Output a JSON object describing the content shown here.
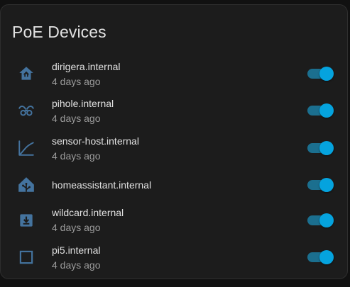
{
  "card": {
    "title": "PoE Devices"
  },
  "colors": {
    "icon": "#44739e",
    "toggle_on": "#05a3de",
    "toggle_track": "#1b6f8f"
  },
  "devices": [
    {
      "name": "dirigera.internal",
      "last_changed": "4 days ago",
      "icon": "home-hub-icon",
      "on": true
    },
    {
      "name": "pihole.internal",
      "last_changed": "4 days ago",
      "icon": "pi-hole-icon",
      "on": true
    },
    {
      "name": "sensor-host.internal",
      "last_changed": "4 days ago",
      "icon": "chart-line-icon",
      "on": true
    },
    {
      "name": "homeassistant.internal",
      "last_changed": "",
      "icon": "home-assistant-icon",
      "on": true
    },
    {
      "name": "wildcard.internal",
      "last_changed": "4 days ago",
      "icon": "tray-arrow-down-icon",
      "on": true
    },
    {
      "name": "pi5.internal",
      "last_changed": "4 days ago",
      "icon": "square-outline-icon",
      "on": true
    }
  ]
}
